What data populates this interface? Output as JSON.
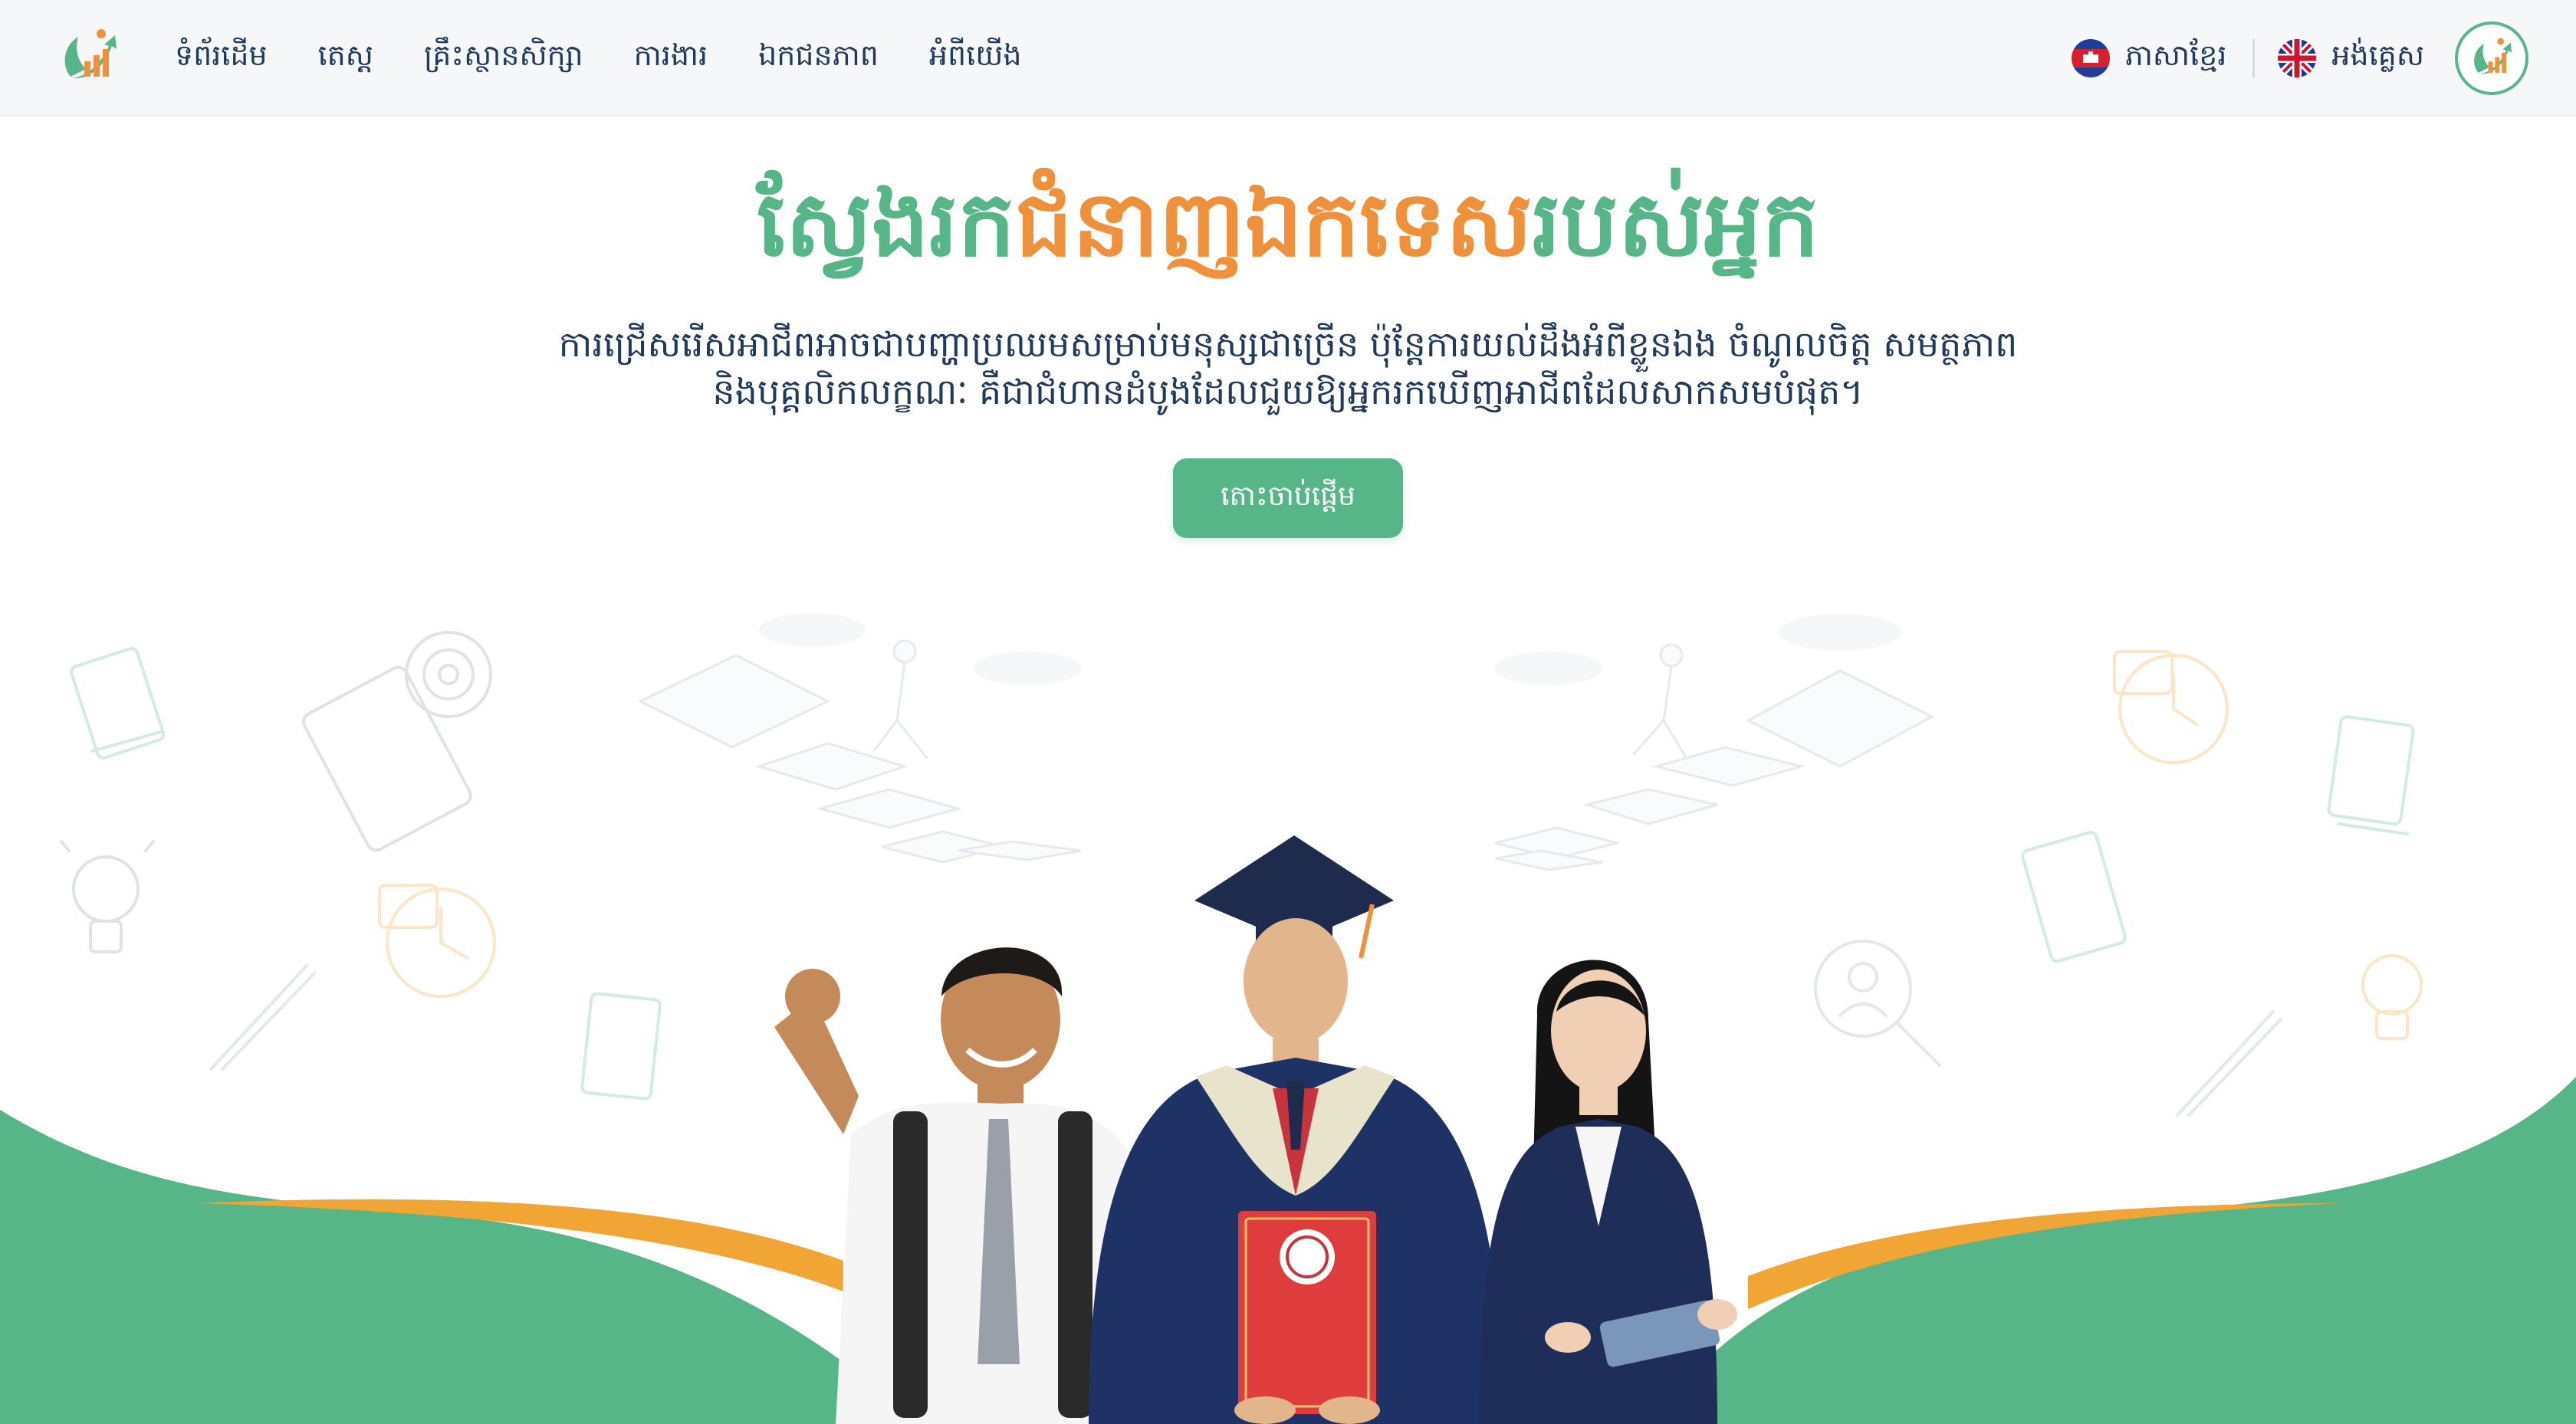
{
  "nav": {
    "logo_icon": "career-growth-logo",
    "links": [
      {
        "label": "ទំព័រដើម"
      },
      {
        "label": "តេស្ត"
      },
      {
        "label": "គ្រឹះស្ថានសិក្សា"
      },
      {
        "label": "ការងារ"
      },
      {
        "label": "ឯកជនភាព"
      },
      {
        "label": "អំពីយើង"
      }
    ],
    "languages": [
      {
        "label": "ភាសាខ្មែរ",
        "flag_icon": "cambodia-flag-icon"
      },
      {
        "label": "អង់គ្លេស",
        "flag_icon": "uk-flag-icon"
      }
    ],
    "avatar_icon": "career-growth-logo"
  },
  "hero": {
    "title_part1": "ស្វែងរក",
    "title_part2": "ជំនាញឯកទេស",
    "title_part3": "របស់អ្នក",
    "description_line1": "ការជ្រើសរើសអាជីពអាចជាបញ្ហាប្រឈមសម្រាប់មនុស្សជាច្រើន ប៉ុន្តែការយល់ដឹងអំពីខ្លួនឯង ចំណូលចិត្ត សមត្ថភាព",
    "description_line2": "និងបុគ្គលិកលក្ខណៈ គឺជាជំហានដំបូងដែលជួយឱ្យអ្នករកឃើញអាជីពដែលសាកសមបំផុត។",
    "cta_label": "តោះចាប់ផ្តើម"
  },
  "colors": {
    "primary_green": "#56b688",
    "accent_orange": "#ee913a",
    "text_navy": "#1f3a5a",
    "wave_orange": "#f0a535"
  },
  "illustration": {
    "subjects": [
      "student-with-backpack",
      "graduate-with-diploma",
      "professional-with-tablet"
    ],
    "background_icons": [
      "book-icon",
      "clipboard-target-icon",
      "lightbulb-icon",
      "clock-briefcase-icon",
      "pen-icon",
      "magnifier-person-icon",
      "stairs-climber-icon"
    ]
  }
}
